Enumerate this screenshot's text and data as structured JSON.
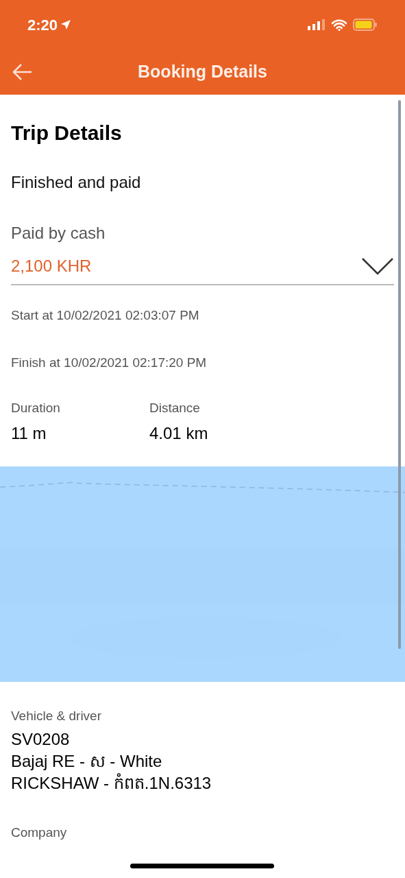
{
  "status_bar": {
    "time": "2:20"
  },
  "header": {
    "title": "Booking Details"
  },
  "trip": {
    "title": "Trip Details",
    "status": "Finished and paid",
    "payment_method": "Paid by cash",
    "amount": "2,100 KHR",
    "expanded": false,
    "start": "Start at 10/02/2021 02:03:07 PM",
    "finish": "Finish at 10/02/2021 02:17:20 PM",
    "stats": [
      {
        "label": "Duration",
        "value": "11 m"
      },
      {
        "label": "Distance",
        "value": "4.01 km"
      }
    ]
  },
  "vehicle": {
    "label": "Vehicle & driver",
    "lines": [
      "SV0208",
      "Bajaj RE - ស - White",
      "RICKSHAW - កំពត.1N.6313"
    ]
  },
  "company": {
    "label": "Company"
  }
}
